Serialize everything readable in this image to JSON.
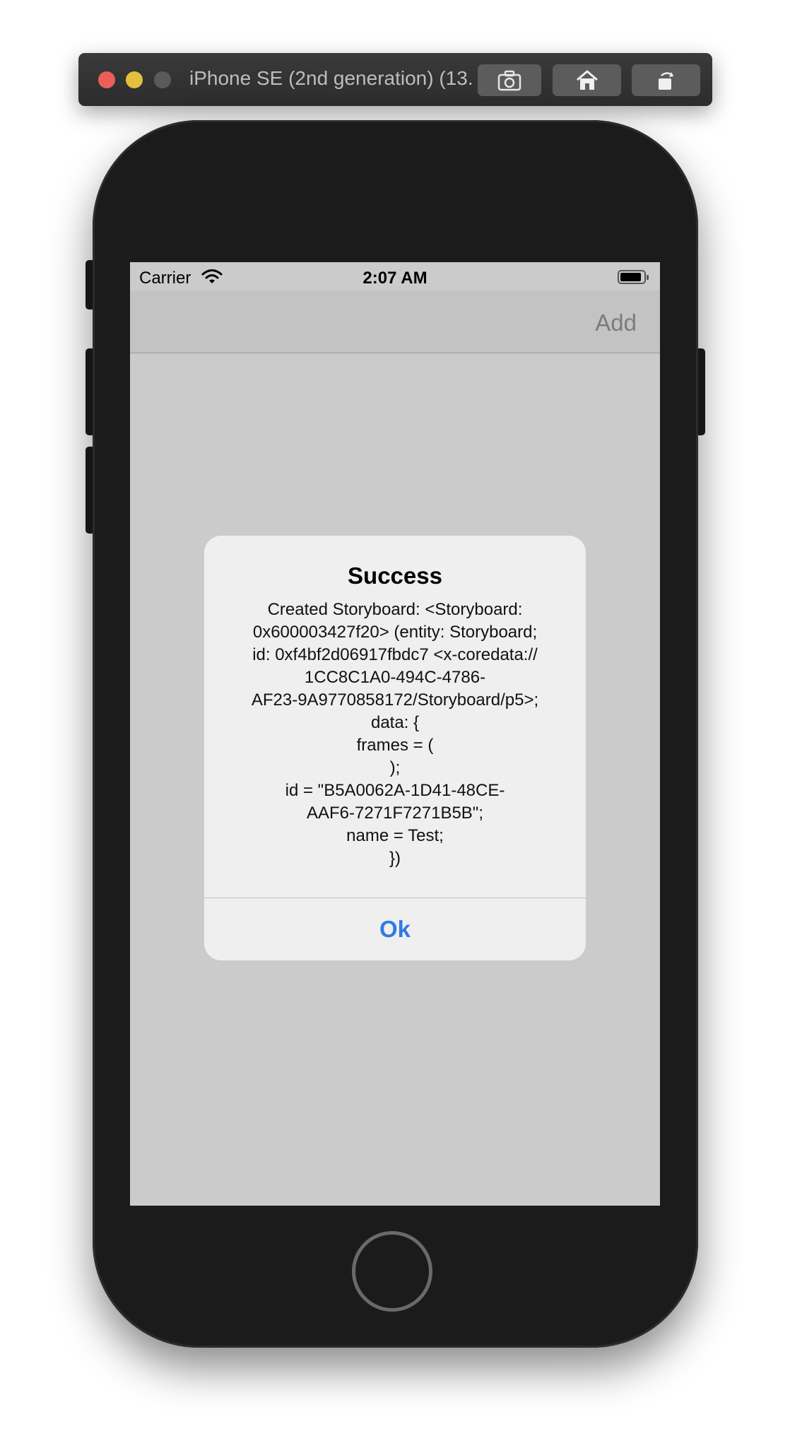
{
  "simulator": {
    "title": "iPhone SE (2nd generation) (13...",
    "buttons": {
      "screenshot_icon": "camera-icon",
      "home_icon": "home-icon",
      "rotate_icon": "rotate-icon"
    }
  },
  "status_bar": {
    "carrier": "Carrier",
    "time": "2:07 AM"
  },
  "navbar": {
    "add_label": "Add"
  },
  "alert": {
    "title": "Success",
    "message": "Created Storyboard: <Storyboard:\n0x600003427f20> (entity: Storyboard;\nid: 0xf4bf2d06917fbdc7 <x-coredata://\n1CC8C1A0-494C-4786-\nAF23-9A9770858172/Storyboard/p5>;\ndata: {\nframes =     (\n);\nid = \"B5A0062A-1D41-48CE-\nAAF6-7271F7271B5B\";\nname = Test;\n})",
    "ok_label": "Ok"
  },
  "colors": {
    "accent": "#2f7ae5",
    "screen_background": "#cbcbcb",
    "alert_background": "#efefef"
  }
}
